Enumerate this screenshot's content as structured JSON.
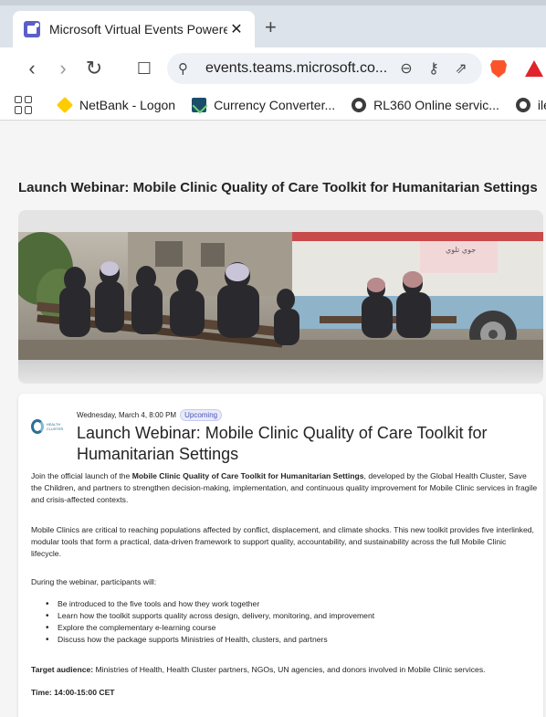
{
  "browser": {
    "tab_title": "Microsoft Virtual Events Powered",
    "tab_close": "✕",
    "new_tab": "+",
    "url": "events.teams.microsoft.co...",
    "accent_colors": {
      "teams": "#5b5fc7",
      "brave": "#fb542b"
    }
  },
  "toolbar": {
    "back_icon": "‹",
    "forward_icon": "›",
    "reload_icon": "↻",
    "bookmark_icon": "☐",
    "site_info_icon": "⚲",
    "zoom_icon": "⊖",
    "key_icon": "⚷",
    "share_icon": "⇗"
  },
  "bookmarks": [
    {
      "label": "NetBank - Logon",
      "icon": "netbank-icon"
    },
    {
      "label": "Currency Converter...",
      "icon": "currency-converter-icon"
    },
    {
      "label": "RL360 Online servic...",
      "icon": "globe-icon"
    },
    {
      "label": "ilearn",
      "icon": "globe-icon"
    }
  ],
  "page": {
    "title": "Launch Webinar: Mobile Clinic Quality of Care Toolkit for Humanitarian Settings",
    "hero_sign_text": "جوي تلوي",
    "event": {
      "org_logo_text": "HEALTH CLUSTER",
      "date": "Wednesday, March 4, 8:00 PM",
      "status_badge": "Upcoming",
      "title": "Launch Webinar: Mobile Clinic Quality of Care Toolkit for Humanitarian Settings",
      "p1_a": "Join the official launch of the ",
      "p1_b": "Mobile Clinic Quality of Care Toolkit for Humanitarian Settings",
      "p1_c": ", developed by the Global Health Cluster, Save the Children, and partners to strengthen decision-making, implementation, and continuous quality improvement for Mobile Clinic services in fragile and crisis-affected contexts.",
      "p2": "Mobile Clinics are critical to reaching populations affected by conflict, displacement, and climate shocks. This new toolkit provides five interlinked, modular tools that form a practical, data-driven framework to support quality, accountability, and sustainability across the full Mobile Clinic lifecycle.",
      "p3": "During the webinar, participants will:",
      "bullets": [
        "Be introduced to the five tools and how they work together",
        "Learn how the toolkit supports quality across design, delivery, monitoring, and improvement",
        "Explore the complementary e-learning course",
        "Discuss how the package supports Ministries of Health, clusters, and partners"
      ],
      "audience_label": "Target audience:",
      "audience_text": " Ministries of Health, Health Cluster partners, NGOs, UN agencies, and donors involved in Mobile Clinic services.",
      "time": "Time: 14:00-15:00 CET"
    }
  }
}
